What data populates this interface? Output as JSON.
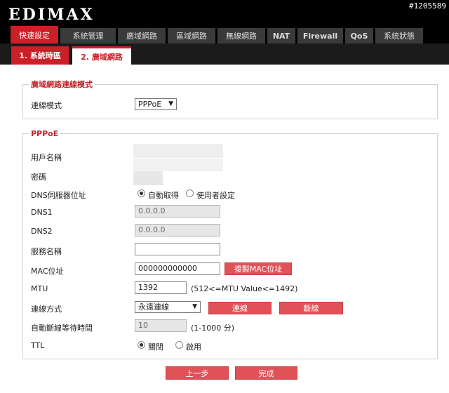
{
  "brand": {
    "logo": "EDIMAX",
    "watermark": "#1205589"
  },
  "main_tabs": [
    {
      "label": "快速設定"
    },
    {
      "label": "系統管理"
    },
    {
      "label": "廣域網路"
    },
    {
      "label": "區域網路"
    },
    {
      "label": "無線網路"
    },
    {
      "label": "NAT"
    },
    {
      "label": "Firewall"
    },
    {
      "label": "QoS"
    },
    {
      "label": "系統狀態"
    }
  ],
  "sub_tabs": [
    {
      "label": "1. 系統時區"
    },
    {
      "label": "2. 廣域網路"
    }
  ],
  "wan_mode": {
    "legend": "廣域網路連線模式",
    "label": "連線模式",
    "selected": "PPPoE"
  },
  "pppoe": {
    "legend": "PPPoE",
    "username_label": "用戶名稱",
    "password_label": "密碼",
    "dns_label": "DNS伺服器位址",
    "dns_auto": "自動取得",
    "dns_manual": "使用者設定",
    "dns1_label": "DNS1",
    "dns1_value": "0.0.0.0",
    "dns2_label": "DNS2",
    "dns2_value": "0.0.0.0",
    "service_label": "服務名稱",
    "service_value": "",
    "mac_label": "MAC位址",
    "mac_value": "000000000000",
    "clone_mac": "複製MAC位址",
    "mtu_label": "MTU",
    "mtu_value": "1392",
    "mtu_hint": "(512<=MTU Value<=1492)",
    "conn_type_label": "連線方式",
    "conn_type_value": "永遠連線",
    "connect": "連線",
    "disconnect": "斷線",
    "idle_label": "自動斷線等待時間",
    "idle_value": "10",
    "idle_hint": "(1-1000 分)",
    "ttl_label": "TTL",
    "ttl_off": "關閉",
    "ttl_on": "啟用"
  },
  "nav": {
    "back": "上一步",
    "finish": "完成"
  },
  "colors": {
    "accent": "#cc1f27",
    "button": "#e05258",
    "header": "#000000"
  }
}
